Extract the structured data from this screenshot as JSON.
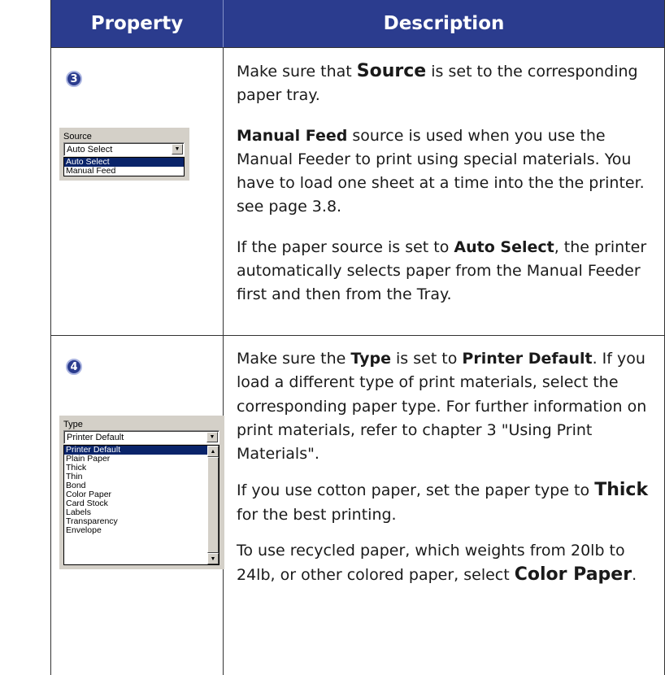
{
  "header": {
    "property": "Property",
    "description": "Description"
  },
  "row1": {
    "step": "3",
    "widget": {
      "label": "Source",
      "selected": "Auto Select",
      "options": [
        "Auto Select",
        "Manual Feed"
      ]
    },
    "p1": {
      "a": "Make sure that ",
      "b": "Source",
      "c": " is set to the corresponding paper tray."
    },
    "p2": {
      "b": "Manual Feed",
      "c": " source is used when you use the Manual Feeder to print using special materials. You have to load one sheet at a time into the the printer. see page 3.8."
    },
    "p3": {
      "a": "If the paper source is set to ",
      "b": "Auto Select",
      "c": ", the printer automatically selects paper from the Manual Feeder first and then from the Tray."
    }
  },
  "row2": {
    "step": "4",
    "widget": {
      "label": "Type",
      "selected": "Printer Default",
      "options": [
        "Printer Default",
        "Plain Paper",
        "Thick",
        "Thin",
        "Bond",
        "Color Paper",
        "Card Stock",
        "Labels",
        "Transparency",
        "Envelope"
      ]
    },
    "p1": {
      "a": "Make sure the ",
      "b": "Type",
      "c": " is set to ",
      "d": "Printer Default",
      "e": ". If you load a different type of print materials, select the corresponding paper type. For further information on print materials, refer to chapter 3 \"Using Print Materials\"."
    },
    "p2": {
      "a": "If you use cotton paper, set the paper type to ",
      "b": "Thick",
      "c": " for the best printing."
    },
    "p3": {
      "a": "To use recycled paper, which weights from 20lb to 24lb, or other colored paper, select ",
      "b": "Color Paper",
      "c": "."
    }
  },
  "colors": {
    "header_bg": "#2b3c8e",
    "header_text": "#ffffff",
    "selection": "#0a246a"
  },
  "icons": {
    "step_badge": "circled-number",
    "dropdown_arrow": "triangle-down",
    "scroll_up": "triangle-up",
    "scroll_down": "triangle-down"
  }
}
